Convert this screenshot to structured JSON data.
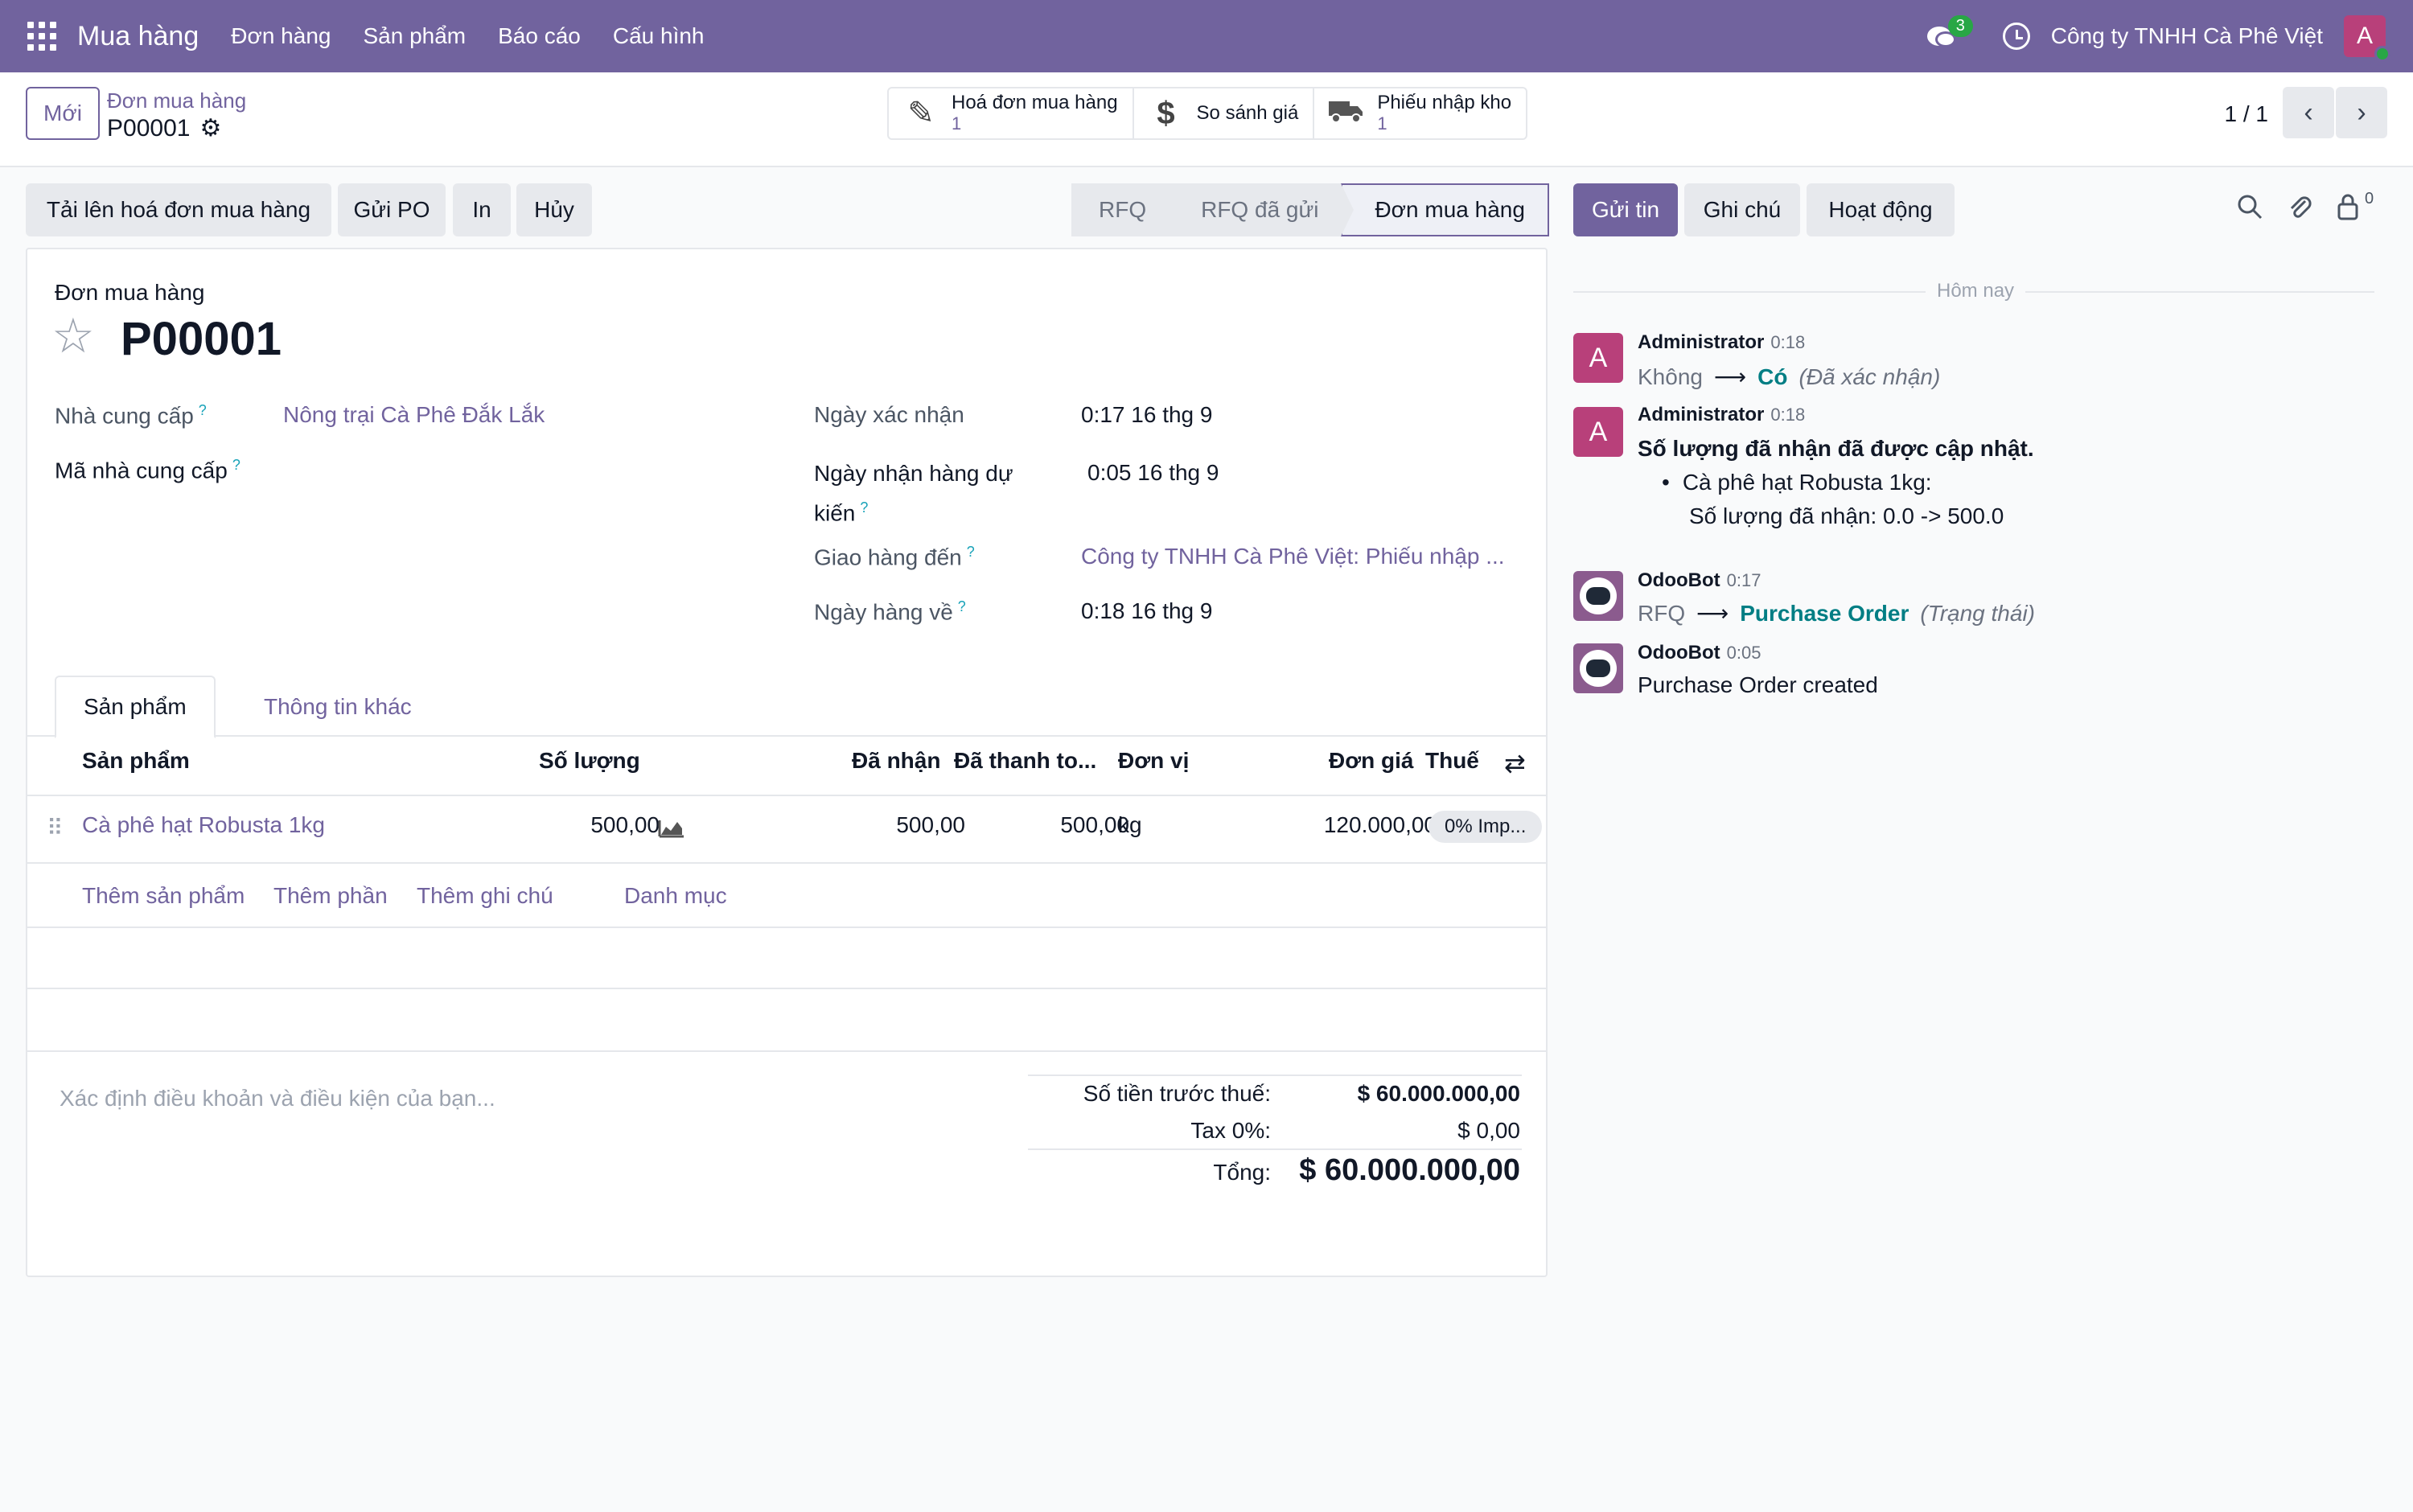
{
  "navbar": {
    "brand": "Mua hàng",
    "menu": [
      "Đơn hàng",
      "Sản phẩm",
      "Báo cáo",
      "Cấu hình"
    ],
    "chat_count": "3",
    "company": "Công ty TNHH Cà Phê Việt",
    "user_initial": "A"
  },
  "control": {
    "new_button": "Mới",
    "breadcrumb_parent": "Đơn mua hàng",
    "breadcrumb_current": "P00001",
    "smart_buttons": [
      {
        "label": "Hoá đơn mua hàng",
        "count": "1",
        "icon": "edit-icon"
      },
      {
        "label": "So sánh giá",
        "count": "",
        "icon": "dollar-icon"
      },
      {
        "label": "Phiếu nhập kho",
        "count": "1",
        "icon": "truck-icon"
      }
    ],
    "pager": "1 / 1"
  },
  "actions": {
    "upload_bill": "Tải lên hoá đơn mua hàng",
    "send_po": "Gửi PO",
    "print": "In",
    "cancel": "Hủy"
  },
  "status": {
    "stages": [
      "RFQ",
      "RFQ đã gửi",
      "Đơn mua hàng"
    ],
    "active": "Đơn mua hàng"
  },
  "form": {
    "doc_type": "Đơn mua hàng",
    "name": "P00001",
    "vendor_label": "Nhà cung cấp",
    "vendor_value": "Nông trại Cà Phê Đắk Lắk",
    "vendor_ref_label": "Mã nhà cung cấp",
    "confirm_date_label": "Ngày xác nhận",
    "confirm_date_value": "0:17 16 thg 9",
    "expected_label_1": "Ngày nhận hàng dự",
    "expected_label_2": "kiến",
    "expected_value": "0:05 16 thg 9",
    "deliver_to_label": "Giao hàng đến",
    "deliver_to_value": "Công ty TNHH Cà Phê Việt: Phiếu nhập ...",
    "arrival_label": "Ngày hàng về",
    "arrival_value": "0:18 16 thg 9",
    "help_mark": "?"
  },
  "tabs": {
    "products": "Sản phẩm",
    "other_info": "Thông tin khác"
  },
  "table": {
    "headers": {
      "product": "Sản phẩm",
      "qty": "Số lượng",
      "received": "Đã nhận",
      "billed": "Đã thanh to...",
      "uom": "Đơn vị",
      "price": "Đơn giá",
      "tax": "Thuế"
    },
    "rows": [
      {
        "product": "Cà phê hạt Robusta 1kg",
        "qty": "500,00",
        "received": "500,00",
        "billed": "500,00",
        "uom": "kg",
        "price": "120.000,00",
        "tax": "0% Imp..."
      }
    ],
    "add_links": [
      "Thêm sản phẩm",
      "Thêm phần",
      "Thêm ghi chú",
      "Danh mục"
    ]
  },
  "totals": {
    "terms_placeholder": "Xác định điều khoản và điều kiện của bạn...",
    "untaxed_label": "Số tiền trước thuế:",
    "untaxed_value": "$ 60.000.000,00",
    "tax_label": "Tax 0%:",
    "tax_value": "$ 0,00",
    "total_label": "Tổng:",
    "total_value": "$ 60.000.000,00"
  },
  "chatter": {
    "send_message": "Gửi tin",
    "log_note": "Ghi chú",
    "activities": "Hoạt động",
    "followers_count": "0",
    "day_separator": "Hôm nay",
    "messages": [
      {
        "author": "Administrator",
        "time": "0:18",
        "old": "Không",
        "new": "Có",
        "field": "(Đã xác nhận)"
      },
      {
        "author": "Administrator",
        "time": "0:18",
        "title": "Số lượng đã nhận đã được cập nhật.",
        "bullet": "Cà phê hạt Robusta 1kg:",
        "detail": "Số lượng đã nhận: 0.0 -> 500.0"
      },
      {
        "author": "OdooBot",
        "time": "0:17",
        "old": "RFQ",
        "new": "Purchase Order",
        "field": "(Trạng thái)"
      },
      {
        "author": "OdooBot",
        "time": "0:05",
        "body": "Purchase Order created"
      }
    ]
  },
  "colors": {
    "brand": "#71639e",
    "link_teal": "#017e84",
    "help_teal": "#17a2b8",
    "badge_green": "#28a745",
    "avatar_admin": "#b8407a"
  }
}
